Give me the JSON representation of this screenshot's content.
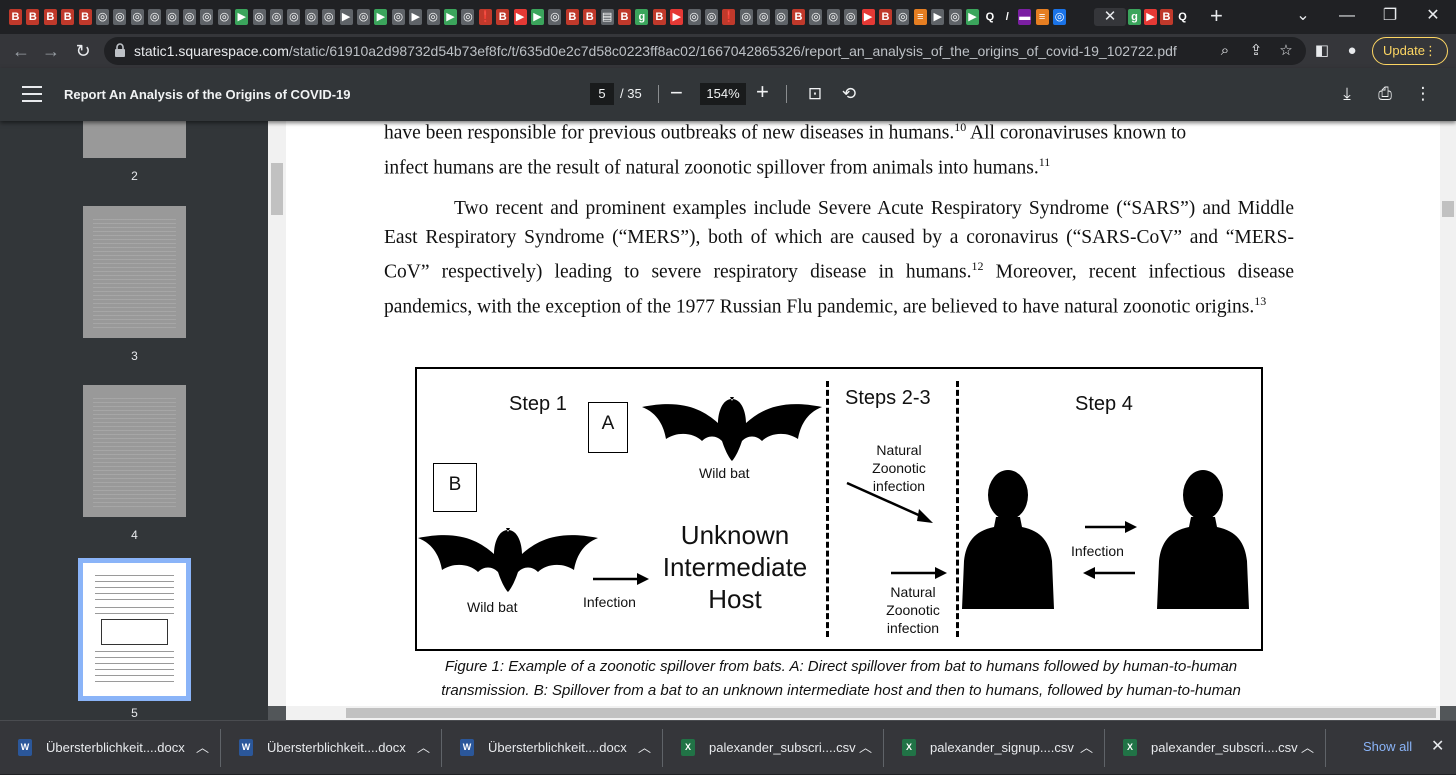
{
  "tabs": {
    "favicons": [
      {
        "glyph": "B",
        "bg": "#c0392b"
      },
      {
        "glyph": "B",
        "bg": "#c0392b"
      },
      {
        "glyph": "B",
        "bg": "#c0392b"
      },
      {
        "glyph": "B",
        "bg": "#c0392b"
      },
      {
        "glyph": "B",
        "bg": "#c0392b"
      },
      {
        "glyph": "◎",
        "bg": "#5f6368"
      },
      {
        "glyph": "◎",
        "bg": "#5f6368"
      },
      {
        "glyph": "◎",
        "bg": "#5f6368"
      },
      {
        "glyph": "◎",
        "bg": "#5f6368"
      },
      {
        "glyph": "◎",
        "bg": "#5f6368"
      },
      {
        "glyph": "◎",
        "bg": "#5f6368"
      },
      {
        "glyph": "◎",
        "bg": "#5f6368"
      },
      {
        "glyph": "◎",
        "bg": "#5f6368"
      },
      {
        "glyph": "▶",
        "bg": "#3ba55c"
      },
      {
        "glyph": "◎",
        "bg": "#5f6368"
      },
      {
        "glyph": "◎",
        "bg": "#5f6368"
      },
      {
        "glyph": "◎",
        "bg": "#5f6368"
      },
      {
        "glyph": "◎",
        "bg": "#5f6368"
      },
      {
        "glyph": "◎",
        "bg": "#5f6368"
      },
      {
        "glyph": "▶",
        "bg": "#5f6368"
      },
      {
        "glyph": "◎",
        "bg": "#5f6368"
      },
      {
        "glyph": "▶",
        "bg": "#3ba55c"
      },
      {
        "glyph": "◎",
        "bg": "#5f6368"
      },
      {
        "glyph": "▶",
        "bg": "#5f6368"
      },
      {
        "glyph": "◎",
        "bg": "#5f6368"
      },
      {
        "glyph": "▶",
        "bg": "#3ba55c"
      },
      {
        "glyph": "◎",
        "bg": "#5f6368"
      },
      {
        "glyph": "❗",
        "bg": "#c0392b"
      },
      {
        "glyph": "B",
        "bg": "#c0392b"
      },
      {
        "glyph": "▶",
        "bg": "#e53935"
      },
      {
        "glyph": "▶",
        "bg": "#3ba55c"
      },
      {
        "glyph": "◎",
        "bg": "#5f6368"
      },
      {
        "glyph": "B",
        "bg": "#c0392b"
      },
      {
        "glyph": "B",
        "bg": "#c0392b"
      },
      {
        "glyph": "▤",
        "bg": "#5f6368"
      },
      {
        "glyph": "B",
        "bg": "#c0392b"
      },
      {
        "glyph": "g",
        "bg": "#3ba55c"
      },
      {
        "glyph": "B",
        "bg": "#c0392b"
      },
      {
        "glyph": "▶",
        "bg": "#e53935"
      },
      {
        "glyph": "◎",
        "bg": "#5f6368"
      },
      {
        "glyph": "◎",
        "bg": "#5f6368"
      },
      {
        "glyph": "❗",
        "bg": "#c0392b"
      },
      {
        "glyph": "◎",
        "bg": "#5f6368"
      },
      {
        "glyph": "◎",
        "bg": "#5f6368"
      },
      {
        "glyph": "◎",
        "bg": "#5f6368"
      },
      {
        "glyph": "B",
        "bg": "#c0392b"
      },
      {
        "glyph": "◎",
        "bg": "#5f6368"
      },
      {
        "glyph": "◎",
        "bg": "#5f6368"
      },
      {
        "glyph": "◎",
        "bg": "#5f6368"
      },
      {
        "glyph": "▶",
        "bg": "#e53935"
      },
      {
        "glyph": "B",
        "bg": "#c0392b"
      },
      {
        "glyph": "◎",
        "bg": "#5f6368"
      },
      {
        "glyph": "≡",
        "bg": "#e67e22"
      },
      {
        "glyph": "▶",
        "bg": "#5f6368"
      },
      {
        "glyph": "◎",
        "bg": "#5f6368"
      },
      {
        "glyph": "▶",
        "bg": "#3ba55c"
      },
      {
        "glyph": "Q",
        "bg": "#202124"
      },
      {
        "glyph": "/",
        "bg": "#202124"
      },
      {
        "glyph": "▬",
        "bg": "#7b1fa2"
      },
      {
        "glyph": "≡",
        "bg": "#e67e22"
      },
      {
        "glyph": "◎",
        "bg": "#1a73e8"
      }
    ],
    "after_active": [
      {
        "glyph": "g",
        "bg": "#3ba55c"
      },
      {
        "glyph": "▶",
        "bg": "#e53935"
      },
      {
        "glyph": "B",
        "bg": "#c0392b"
      },
      {
        "glyph": "Q",
        "bg": "#202124"
      }
    ]
  },
  "address_bar": {
    "host": "static1.squarespace.com",
    "path": "/static/61910a2d98732d54b73ef8fc/t/635d0e2c7d58c0223ff8ac02/1667042865326/report_an_analysis_of_the_origins_of_covid-19_102722.pdf",
    "update_label": "Update"
  },
  "pdf_toolbar": {
    "title": "Report An Analysis of the Origins of COVID-19",
    "current_page": "5",
    "total_pages": "/ 35",
    "zoom": "154%"
  },
  "thumbnails": [
    {
      "num": "2"
    },
    {
      "num": "3"
    },
    {
      "num": "4"
    },
    {
      "num": "5"
    }
  ],
  "page": {
    "para1_line1": "have been responsible for previous outbreaks of new diseases in humans.",
    "para1_sup1": "10",
    "para1_line1b": " All coronaviruses known to",
    "para1_line2": "infect humans are the result of natural zoonotic spillover from animals into humans.",
    "para1_sup2": "11",
    "para2_text": "Two recent and prominent examples include Severe Acute Respiratory Syndrome (“SARS”) and Middle East Respiratory Syndrome (“MERS”), both of which are caused by a coronavirus (“SARS-CoV” and “MERS-CoV” respectively) leading to severe respiratory disease in humans.",
    "para2_sup1": "12",
    "para2_text2": " Moreover, recent infectious disease pandemics, with the exception of the 1977 Russian Flu pandemic, are believed to have natural zoonotic origins.",
    "para2_sup2": "13",
    "figure": {
      "step1": "Step 1",
      "step23": "Steps 2-3",
      "step4": "Step 4",
      "box_a": "A",
      "box_b": "B",
      "wild_bat_top": "Wild bat",
      "wild_bat_bottom": "Wild bat",
      "infection_left": "Infection",
      "intermediate_1": "Unknown",
      "intermediate_2": "Intermediate",
      "intermediate_3": "Host",
      "natural_top_1": "Natural",
      "natural_top_2": "Zoonotic",
      "natural_top_3": "infection",
      "natural_bot_1": "Natural",
      "natural_bot_2": "Zoonotic",
      "natural_bot_3": "infection",
      "infection_right": "Infection"
    },
    "caption_line1": "Figure 1: Example of a zoonotic spillover from bats. A: Direct spillover from bat to humans followed by human-to-human",
    "caption_line2": "transmission. B: Spillover from a bat to an unknown intermediate host and then to humans, followed by human-to-human"
  },
  "downloads": {
    "items": [
      {
        "name": "Übersterblichkeit....docx",
        "type": "W",
        "color": "#2b579a"
      },
      {
        "name": "Übersterblichkeit....docx",
        "type": "W",
        "color": "#2b579a"
      },
      {
        "name": "Übersterblichkeit....docx",
        "type": "W",
        "color": "#2b579a"
      },
      {
        "name": "palexander_subscri....csv",
        "type": "X",
        "color": "#217346"
      },
      {
        "name": "palexander_signup....csv",
        "type": "X",
        "color": "#217346"
      },
      {
        "name": "palexander_subscri....csv",
        "type": "X",
        "color": "#217346"
      }
    ],
    "show_all": "Show all"
  }
}
